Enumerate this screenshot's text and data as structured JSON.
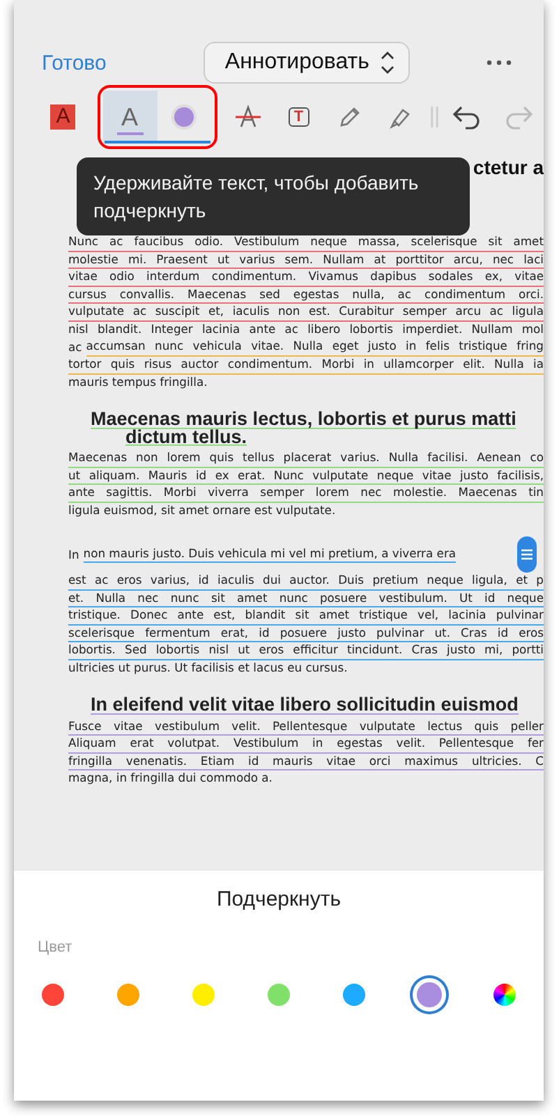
{
  "top_bar": {
    "done": "Готово",
    "mode": "Аннотировать"
  },
  "toolbar": [
    {
      "kind": "text-color",
      "glyph": "A",
      "selected": false
    },
    {
      "kind": "underline",
      "glyph": "A",
      "selected": true,
      "color": "#a78bdb"
    },
    {
      "kind": "color",
      "selected": false,
      "color": "#a78bdb"
    },
    {
      "kind": "strike",
      "selected": false
    },
    {
      "kind": "textbox",
      "glyph": "T",
      "selected": false
    },
    {
      "kind": "pencil",
      "selected": false
    },
    {
      "kind": "marker",
      "selected": false
    },
    {
      "kind": "separator"
    },
    {
      "kind": "undo",
      "disabled": false
    },
    {
      "kind": "redo",
      "disabled": true
    }
  ],
  "tooltip": "Удерживайте текст, чтобы добавить подчеркнуть",
  "heading_fragment": "ctetur a",
  "document": [
    {
      "kind": "paragraph",
      "lines": [
        {
          "text": "Nunc ac faucibus odio. Vestibulum neque massa, scelerisque sit amet",
          "color": "#e8707a"
        },
        {
          "text": "molestie mi. Praesent ut varius sem. Nullam at porttitor arcu, nec laci",
          "color": "#e8707a"
        },
        {
          "text": "vitae odio interdum condimentum. Vivamus dapibus sodales ex, vitae",
          "color": "#e8707a"
        },
        {
          "text": "cursus convallis. Maecenas sed egestas nulla, ac condimentum orci.",
          "color": "#e8707a"
        },
        {
          "text": "vulputate ac suscipit et, iaculis non est. Curabitur semper arcu ac ligula",
          "color": "#e8707a"
        },
        {
          "text": "nisl blandit. Integer lacinia ante ac libero lobortis imperdiet. Nullam mol"
        },
        {
          "lead": "ac",
          "text": "accumsan nunc vehicula vitae. Nulla eget justo in felis tristique fring",
          "color": "#f0b848"
        },
        {
          "text": "tortor quis risus auctor condimentum. Morbi in ullamcorper elit. Nulla ia",
          "color": "#f0b848"
        },
        {
          "text": "mauris tempus fringilla."
        }
      ]
    },
    {
      "kind": "heading",
      "lines": [
        {
          "text": "Maecenas mauris lectus, lobortis et purus matti",
          "color": "#90dc80"
        },
        {
          "text": "dictum tellus.",
          "color": "#90dc80"
        }
      ]
    },
    {
      "kind": "paragraph",
      "lines": [
        {
          "text": "Maecenas non lorem quis tellus placerat varius. Nulla facilisi. Aenean co",
          "color": "#90dc80"
        },
        {
          "text": "ut aliquam. Mauris id ex erat. Nunc vulputate neque vitae justo facilisis,",
          "color": "#90dc80"
        },
        {
          "text": "ante sagittis. Morbi viverra semper lorem nec molestie. Maecenas tin",
          "color": "#90dc80"
        },
        {
          "text": "ligula euismod, sit amet ornare est vulputate."
        }
      ]
    },
    {
      "kind": "paragraph",
      "lines": [
        {
          "lead": "In",
          "text": "non mauris justo. Duis vehicula mi vel mi pretium, a viverra era",
          "color": "#4aa8e8",
          "handle": true
        },
        {
          "text": "est ac eros varius, id iaculis dui auctor. Duis pretium neque ligula, et p",
          "color": "#4aa8e8"
        },
        {
          "text": "et. Nulla nec nunc sit amet nunc posuere vestibulum. Ut id neque",
          "color": "#4aa8e8"
        },
        {
          "text": "tristique. Donec ante est, blandit sit amet tristique vel, lacinia pulvinar",
          "color": "#4aa8e8"
        },
        {
          "text": "scelerisque fermentum erat, id posuere justo pulvinar ut. Cras id eros",
          "color": "#4aa8e8"
        },
        {
          "text": "lobortis. Sed lobortis nisl ut eros efficitur tincidunt. Cras justo mi, portti",
          "color": "#4aa8e8"
        },
        {
          "text": "ultricies ut purus. Ut facilisis et lacus eu cursus."
        }
      ]
    },
    {
      "kind": "heading",
      "lines": [
        {
          "text": "In eleifend velit vitae libero sollicitudin euismod",
          "color": "#b09ce0"
        }
      ]
    },
    {
      "kind": "paragraph",
      "lines": [
        {
          "text": "Fusce vitae vestibulum velit. Pellentesque vulputate lectus quis peller",
          "color": "#b09ce0"
        },
        {
          "text": "Aliquam erat volutpat. Vestibulum in egestas velit. Pellentesque fer",
          "color": "#b09ce0"
        },
        {
          "text": "fringilla venenatis. Etiam id mauris vitae orci maximus ultricies. C",
          "color": "#b09ce0"
        },
        {
          "text": "magna, in fringilla dui commodo a."
        }
      ]
    }
  ],
  "sheet": {
    "title": "Подчеркнуть",
    "color_label": "Цвет",
    "colors": [
      {
        "kind": "solid",
        "color": "#ff453a",
        "selected": false
      },
      {
        "kind": "solid",
        "color": "#ffa500",
        "selected": false
      },
      {
        "kind": "solid",
        "color": "#ffee00",
        "selected": false
      },
      {
        "kind": "solid",
        "color": "#80e06a",
        "selected": false
      },
      {
        "kind": "solid",
        "color": "#1eaaff",
        "selected": false
      },
      {
        "kind": "solid",
        "color": "#a98ddf",
        "selected": true
      },
      {
        "kind": "custom",
        "selected": false
      }
    ]
  }
}
